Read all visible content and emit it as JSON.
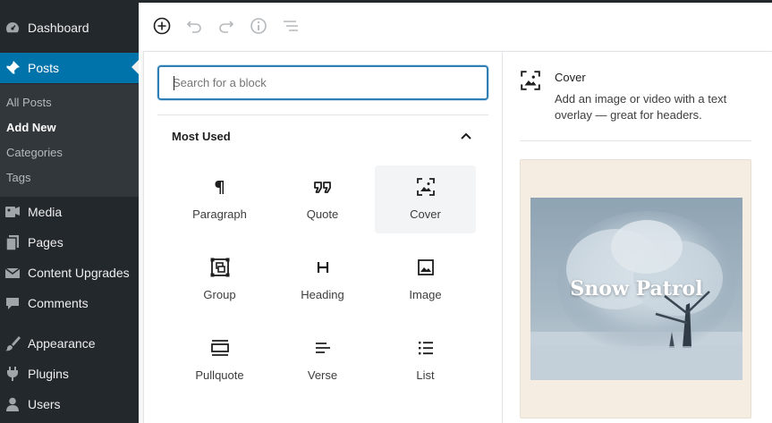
{
  "sidebar": {
    "items": [
      {
        "label": "Dashboard",
        "icon": "dashboard-icon"
      },
      {
        "label": "Posts",
        "icon": "pin-icon",
        "active": true
      },
      {
        "label": "Media",
        "icon": "media-icon"
      },
      {
        "label": "Pages",
        "icon": "pages-icon"
      },
      {
        "label": "Content Upgrades",
        "icon": "mail-icon"
      },
      {
        "label": "Comments",
        "icon": "comment-icon"
      },
      {
        "label": "Appearance",
        "icon": "brush-icon"
      },
      {
        "label": "Plugins",
        "icon": "plug-icon"
      },
      {
        "label": "Users",
        "icon": "user-icon"
      }
    ],
    "submenu": [
      {
        "label": "All Posts"
      },
      {
        "label": "Add New",
        "current": true
      },
      {
        "label": "Categories"
      },
      {
        "label": "Tags"
      }
    ]
  },
  "toolbar": {
    "buttons": [
      "add-block-icon",
      "undo-icon",
      "redo-icon",
      "info-icon",
      "outline-icon"
    ]
  },
  "inserter": {
    "search": {
      "placeholder": "Search for a block",
      "value": ""
    },
    "panel_title": "Most Used",
    "blocks": [
      {
        "label": "Paragraph",
        "icon": "paragraph-icon"
      },
      {
        "label": "Quote",
        "icon": "quote-icon"
      },
      {
        "label": "Cover",
        "icon": "cover-icon",
        "selected": true
      },
      {
        "label": "Group",
        "icon": "group-icon"
      },
      {
        "label": "Heading",
        "icon": "heading-icon"
      },
      {
        "label": "Image",
        "icon": "image-icon"
      },
      {
        "label": "Pullquote",
        "icon": "pullquote-icon"
      },
      {
        "label": "Verse",
        "icon": "verse-icon"
      },
      {
        "label": "List",
        "icon": "list-icon"
      }
    ]
  },
  "preview": {
    "name": "Cover",
    "description": "Add an image or video with a text overlay — great for headers.",
    "cover_text": "Snow Patrol"
  },
  "colors": {
    "sidebar_bg": "#23282d",
    "active_item": "#0073aa",
    "focus_border": "#2f7fb4",
    "preview_bg": "#f5ede2"
  }
}
